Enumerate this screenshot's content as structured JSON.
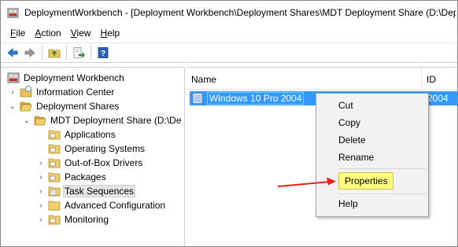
{
  "window": {
    "title": "DeploymentWorkbench - [Deployment Workbench\\Deployment Shares\\MDT Deployment Share (D:\\Dep"
  },
  "menu": [
    {
      "label": "File",
      "accel": "F",
      "rest": "ile"
    },
    {
      "label": "Action",
      "accel": "A",
      "rest": "ction"
    },
    {
      "label": "View",
      "accel": "V",
      "rest": "iew"
    },
    {
      "label": "Help",
      "accel": "H",
      "rest": "elp"
    }
  ],
  "toolbar": {
    "icons": [
      "back-arrow-icon",
      "forward-arrow-icon",
      "up-folder-icon",
      "export-list-icon",
      "help-icon"
    ]
  },
  "tree": {
    "items": [
      {
        "label": "Deployment Workbench"
      },
      {
        "label": "Information Center"
      },
      {
        "label": "Deployment Shares"
      },
      {
        "label": "MDT Deployment Share (D:\\De"
      },
      {
        "label": "Applications"
      },
      {
        "label": "Operating Systems"
      },
      {
        "label": "Out-of-Box Drivers"
      },
      {
        "label": "Packages"
      },
      {
        "label": "Task Sequences"
      },
      {
        "label": "Advanced Configuration"
      },
      {
        "label": "Monitoring"
      }
    ]
  },
  "list": {
    "columns": {
      "name": "Name",
      "id": "ID"
    },
    "rows": [
      {
        "name": "Windows 10 Pro 2004",
        "id": "2004"
      }
    ]
  },
  "context_menu": {
    "items": [
      "Cut",
      "Copy",
      "Delete",
      "Rename",
      "Properties",
      "Help"
    ],
    "highlighted": "Properties"
  },
  "colors": {
    "selection": "#3399ff",
    "highlight": "#ffff80",
    "arrow": "#e8201c"
  }
}
